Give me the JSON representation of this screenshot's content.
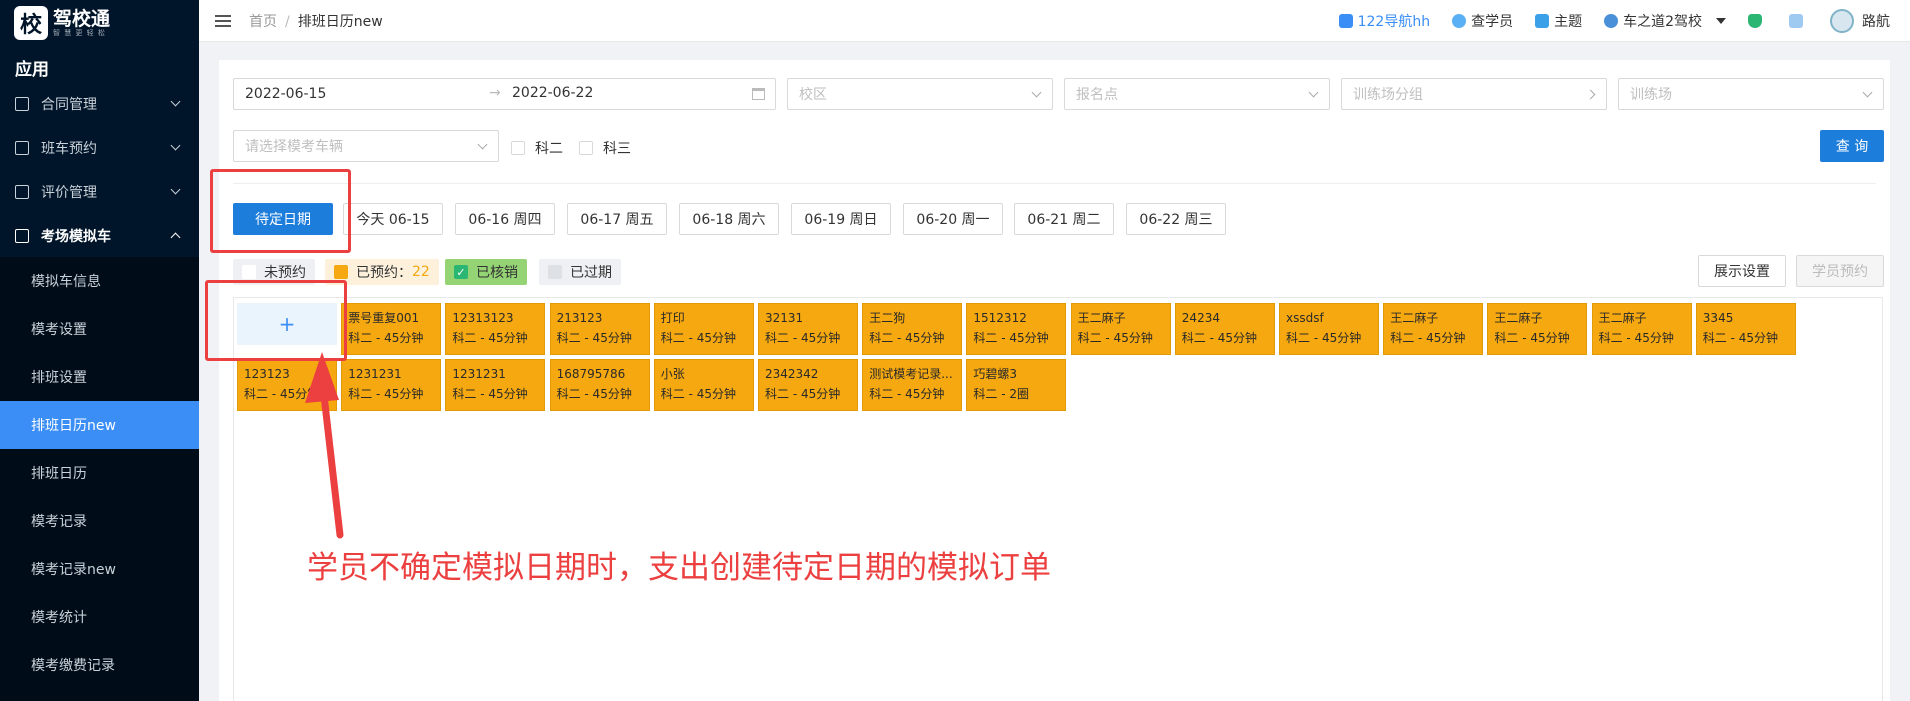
{
  "sidebar": {
    "logo_mark": "校",
    "logo_title": "驾校通",
    "logo_subtitle": "智 慧 更 轻 松",
    "section_title": "应用",
    "groups": [
      {
        "label": "合同管理"
      },
      {
        "label": "班车预约"
      },
      {
        "label": "评价管理"
      },
      {
        "label": "考场模拟车"
      }
    ],
    "sub_items": [
      {
        "label": "模拟车信息"
      },
      {
        "label": "模考设置"
      },
      {
        "label": "排班设置"
      },
      {
        "label": "排班日历new"
      },
      {
        "label": "排班日历"
      },
      {
        "label": "模考记录"
      },
      {
        "label": "模考记录new"
      },
      {
        "label": "模考统计"
      },
      {
        "label": "模考缴费记录"
      }
    ]
  },
  "header": {
    "crumb_home": "首页",
    "crumb_sep": "/",
    "crumb_current": "排班日历new",
    "nav_link": "122导航hh",
    "lookup": "查学员",
    "theme": "主题",
    "school": "车之道2驾校",
    "username": "路航"
  },
  "filters": {
    "date_start": "2022-06-15",
    "range_arrow": "→",
    "date_end": "2022-06-22",
    "campus_ph": "校区",
    "signup_ph": "报名点",
    "group_ph": "训练场分组",
    "field_ph": "训练场",
    "vehicle_ph": "请选择模考车辆",
    "subject2": "科二",
    "subject3": "科三",
    "query_btn": "查 询"
  },
  "date_tabs": [
    {
      "label": "待定日期"
    },
    {
      "label": "今天 06-15"
    },
    {
      "label": "06-16 周四"
    },
    {
      "label": "06-17 周五"
    },
    {
      "label": "06-18 周六"
    },
    {
      "label": "06-19 周日"
    },
    {
      "label": "06-20 周一"
    },
    {
      "label": "06-21 周二"
    },
    {
      "label": "06-22 周三"
    }
  ],
  "legend": {
    "unbooked": "未预约",
    "booked": "已预约：",
    "booked_count": "22",
    "verified": "已核销",
    "expired": "已过期"
  },
  "buttons": {
    "display_settings": "展示设置",
    "student_booking": "学员预约"
  },
  "add_cell": "+",
  "orders": [
    {
      "name": "票号重复001",
      "detail": "科二 - 45分钟"
    },
    {
      "name": "12313123",
      "detail": "科二 - 45分钟"
    },
    {
      "name": "213123",
      "detail": "科二 - 45分钟"
    },
    {
      "name": "打印",
      "detail": "科二 - 45分钟"
    },
    {
      "name": "32131",
      "detail": "科二 - 45分钟"
    },
    {
      "name": "王二狗",
      "detail": "科二 - 45分钟"
    },
    {
      "name": "1512312",
      "detail": "科二 - 45分钟"
    },
    {
      "name": "王二麻子",
      "detail": "科二 - 45分钟"
    },
    {
      "name": "24234",
      "detail": "科二 - 45分钟"
    },
    {
      "name": "xssdsf",
      "detail": "科二 - 45分钟"
    },
    {
      "name": "王二麻子",
      "detail": "科二 - 45分钟"
    },
    {
      "name": "王二麻子",
      "detail": "科二 - 45分钟"
    },
    {
      "name": "王二麻子",
      "detail": "科二 - 45分钟"
    },
    {
      "name": "3345",
      "detail": "科二 - 45分钟"
    },
    {
      "name": "123123",
      "detail": "科二 - 45分钟"
    },
    {
      "name": "1231231",
      "detail": "科二 - 45分钟"
    },
    {
      "name": "1231231",
      "detail": "科二 - 45分钟"
    },
    {
      "name": "168795786",
      "detail": "科二 - 45分钟"
    },
    {
      "name": "小张",
      "detail": "科二 - 45分钟"
    },
    {
      "name": "2342342",
      "detail": "科二 - 45分钟"
    },
    {
      "name": "测试模考记录...",
      "detail": "科二 - 45分钟"
    },
    {
      "name": "巧碧螺3",
      "detail": "科二 - 2圈"
    }
  ],
  "annotation": "学员不确定模拟日期时，支出创建待定日期的模拟订单",
  "colors": {
    "sidebar_bg": "#001529",
    "primary": "#1d7ddb",
    "booked": "#f5a80f",
    "verified": "#95d475",
    "annotation": "#ec4040"
  }
}
